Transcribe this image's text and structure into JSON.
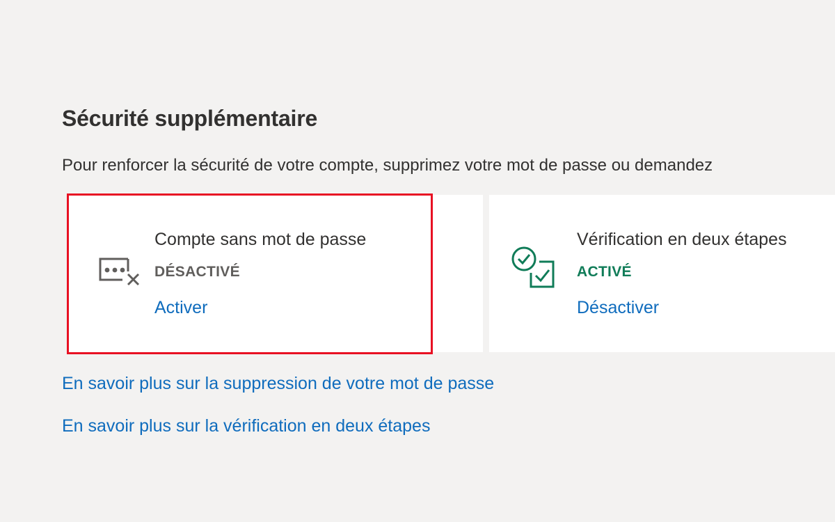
{
  "section": {
    "title": "Sécurité supplémentaire",
    "description": "Pour renforcer la sécurité de votre compte, supprimez votre mot de passe ou demandez"
  },
  "cards": [
    {
      "title": "Compte sans mot de passe",
      "status": "DÉSACTIVÉ",
      "action": "Activer",
      "icon": "password-off-icon"
    },
    {
      "title": "Vérification en deux étapes",
      "status": "ACTIVÉ",
      "action": "Désactiver",
      "icon": "two-step-verification-icon"
    }
  ],
  "links": [
    "En savoir plus sur la suppression de votre mot de passe",
    "En savoir plus sur la vérification en deux étapes"
  ],
  "colors": {
    "background": "#f3f2f1",
    "card": "#ffffff",
    "link": "#0f6cbd",
    "status_on": "#107c58",
    "status_off": "#605e5c",
    "highlight": "#e81123"
  }
}
